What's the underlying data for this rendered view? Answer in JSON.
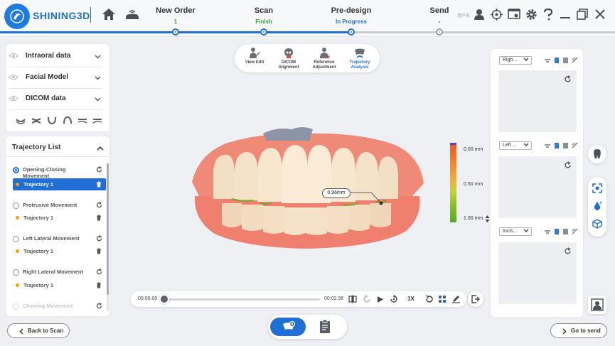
{
  "app": {
    "brand": "SHINING3D",
    "user_name": "用户名"
  },
  "header": {
    "steps": [
      {
        "label": "New Order",
        "status": "1",
        "status_color": "#2a9d3a"
      },
      {
        "label": "Scan",
        "status": "Finish",
        "status_color": "#2a9d3a"
      },
      {
        "label": "Pre-design",
        "status": "In Progress",
        "status_color": "#1f6fd6"
      },
      {
        "label": "Send",
        "status": "-",
        "status_color": "#333333"
      }
    ],
    "icons": [
      "home-icon",
      "cloud-device-icon",
      "user-icon",
      "target-icon",
      "screen-record-icon",
      "gear-icon",
      "help-icon",
      "minimize-icon",
      "restore-icon",
      "close-icon"
    ]
  },
  "data_panel": {
    "items": [
      {
        "label": "Intraoral data"
      },
      {
        "label": "Facial Model"
      },
      {
        "label": "DICOM data"
      }
    ],
    "view_icons": [
      "upper-arch-icon",
      "both-arches-icon",
      "lower-front-icon",
      "upper-front-icon",
      "left-side-icon",
      "right-side-icon"
    ]
  },
  "trajectory_panel": {
    "title": "Trajectory List",
    "movements": [
      {
        "label": "Opening-Closing Movement",
        "selected": true,
        "trajectory": "Trajectory 1",
        "trajectory_selected": true
      },
      {
        "label": "Protrusive Movement",
        "selected": false,
        "trajectory": "Trajectory 1",
        "trajectory_selected": false
      },
      {
        "label": "Left Lateral Movement",
        "selected": false,
        "trajectory": "Trajectory 1",
        "trajectory_selected": false
      },
      {
        "label": "Right Lateral Movement",
        "selected": false,
        "trajectory": "Trajectory 1",
        "trajectory_selected": false
      },
      {
        "label": "Chewing Movement",
        "selected": false,
        "disabled": true
      }
    ]
  },
  "toolbar": {
    "items": [
      {
        "label": "View Edit",
        "active": false
      },
      {
        "label": "DICOM Alignment",
        "active": false
      },
      {
        "label": "Reference Adjustment",
        "active": false
      },
      {
        "label": "Trajectory Analysis",
        "active": true
      }
    ]
  },
  "viewport": {
    "measurement": "0.96mm"
  },
  "legend": {
    "top": "0.00 mm",
    "mid": "0.50 mm",
    "bottom": "1.00 mm"
  },
  "right_panel": {
    "views": [
      {
        "select": "Righ..."
      },
      {
        "select": "Left ..."
      },
      {
        "select": "Incis..."
      }
    ]
  },
  "playback": {
    "current_time": "00:00.00",
    "total_time": "00:02.96",
    "progress": 0,
    "speed": "1X"
  },
  "buttons": {
    "back": "Back to Scan",
    "next": "Go to send"
  },
  "colors": {
    "accent": "#1f6fd6",
    "finish": "#2a9d3a",
    "trajectory_dot": "#f2a20e"
  }
}
